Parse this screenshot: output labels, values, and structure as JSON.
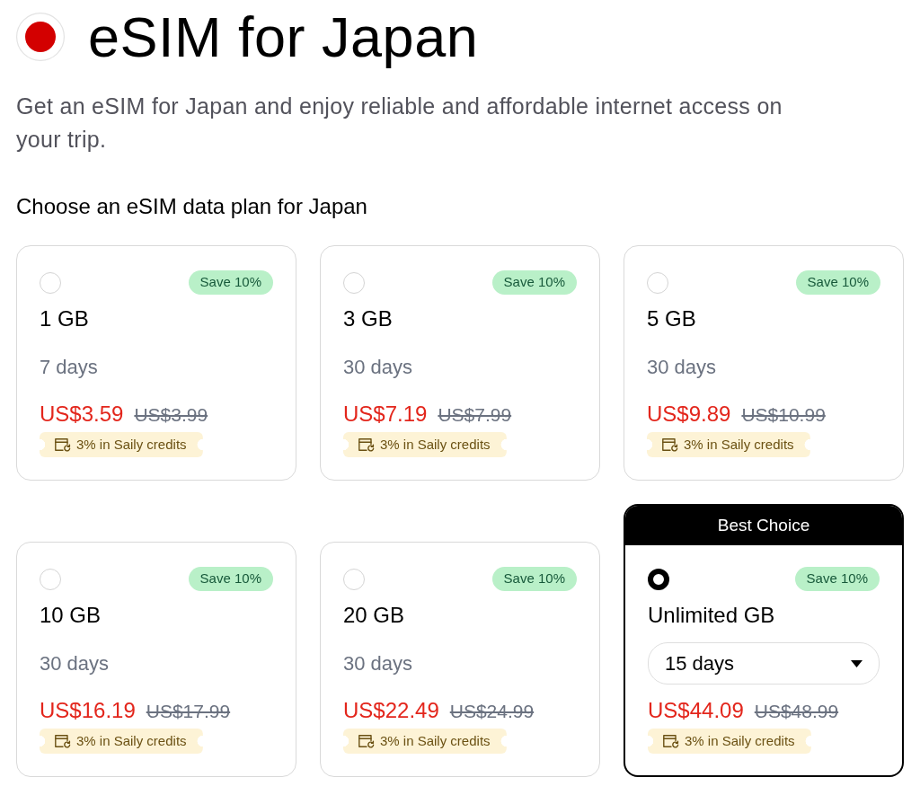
{
  "header": {
    "title": "eSIM for Japan",
    "description": "Get an eSIM for Japan and enjoy reliable and affordable internet access on your trip."
  },
  "section_title": "Choose an eSIM data plan for Japan",
  "plans": [
    {
      "kind": "fixed",
      "selected": false,
      "discount": "Save 10%",
      "data": "1 GB",
      "duration": "7 days",
      "price": "US$3.59",
      "original_price": "US$3.99",
      "credits": "3% in Saily credits"
    },
    {
      "kind": "fixed",
      "selected": false,
      "discount": "Save 10%",
      "data": "3 GB",
      "duration": "30 days",
      "price": "US$7.19",
      "original_price": "US$7.99",
      "credits": "3% in Saily credits"
    },
    {
      "kind": "fixed",
      "selected": false,
      "discount": "Save 10%",
      "data": "5 GB",
      "duration": "30 days",
      "price": "US$9.89",
      "original_price": "US$10.99",
      "credits": "3% in Saily credits"
    },
    {
      "kind": "fixed",
      "selected": false,
      "discount": "Save 10%",
      "data": "10 GB",
      "duration": "30 days",
      "price": "US$16.19",
      "original_price": "US$17.99",
      "credits": "3% in Saily credits"
    },
    {
      "kind": "fixed",
      "selected": false,
      "discount": "Save 10%",
      "data": "20 GB",
      "duration": "30 days",
      "price": "US$22.49",
      "original_price": "US$24.99",
      "credits": "3% in Saily credits"
    },
    {
      "kind": "dropdown",
      "selected": true,
      "ribbon": "Best Choice",
      "discount": "Save 10%",
      "data": "Unlimited GB",
      "duration": "15 days",
      "price": "US$44.09",
      "original_price": "US$48.99",
      "credits": "3% in Saily credits"
    }
  ]
}
